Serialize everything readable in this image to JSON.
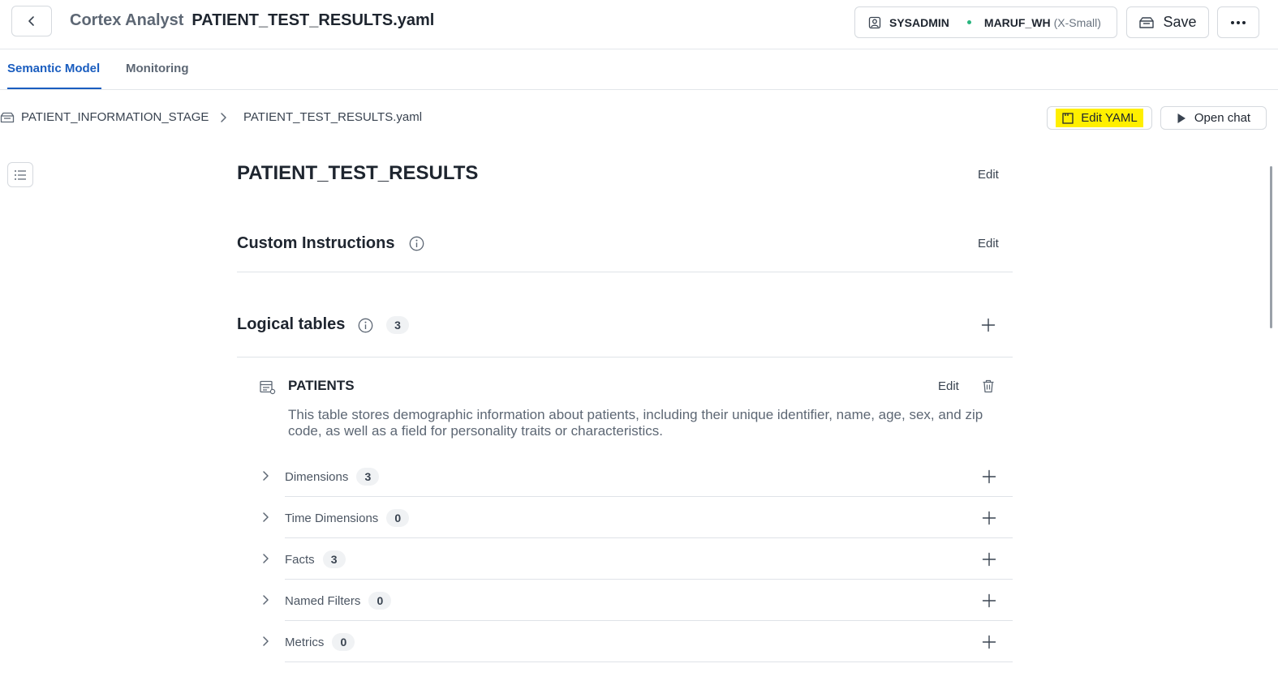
{
  "header": {
    "app_name": "Cortex Analyst",
    "file_name": "PATIENT_TEST_RESULTS.yaml",
    "role": "SYSADMIN",
    "warehouse": "MARUF_WH",
    "warehouse_size": "(X-Small)",
    "save_label": "Save"
  },
  "tabs": [
    {
      "label": "Semantic Model",
      "active": true
    },
    {
      "label": "Monitoring",
      "active": false
    }
  ],
  "breadcrumb": {
    "stage": "PATIENT_INFORMATION_STAGE",
    "file": "PATIENT_TEST_RESULTS.yaml"
  },
  "actions": {
    "edit_yaml_label": "Edit YAML",
    "open_chat_label": "Open chat"
  },
  "model": {
    "title": "PATIENT_TEST_RESULTS",
    "edit_label": "Edit"
  },
  "custom_instructions": {
    "title": "Custom Instructions",
    "edit_label": "Edit"
  },
  "logical_tables": {
    "title": "Logical tables",
    "count": "3",
    "tables": [
      {
        "name": "PATIENTS",
        "edit_label": "Edit",
        "description": "This table stores demographic information about patients, including their unique identifier, name, age, sex, and zip code, as well as a field for personality traits or characteristics.",
        "sections": [
          {
            "label": "Dimensions",
            "count": "3"
          },
          {
            "label": "Time Dimensions",
            "count": "0"
          },
          {
            "label": "Facts",
            "count": "3"
          },
          {
            "label": "Named Filters",
            "count": "0"
          },
          {
            "label": "Metrics",
            "count": "0"
          }
        ]
      }
    ]
  },
  "colors": {
    "accent": "#1a5dbf",
    "highlight": "#ffef00",
    "status_dot": "#29b57e"
  },
  "icons": [
    "chevron-left-icon",
    "user-role-icon",
    "status-dot-icon",
    "save-icon",
    "more-horizontal-icon",
    "stage-icon",
    "chevron-right-icon",
    "yaml-file-icon",
    "play-icon",
    "list-icon",
    "info-icon",
    "plus-icon",
    "table-icon",
    "trash-icon"
  ]
}
